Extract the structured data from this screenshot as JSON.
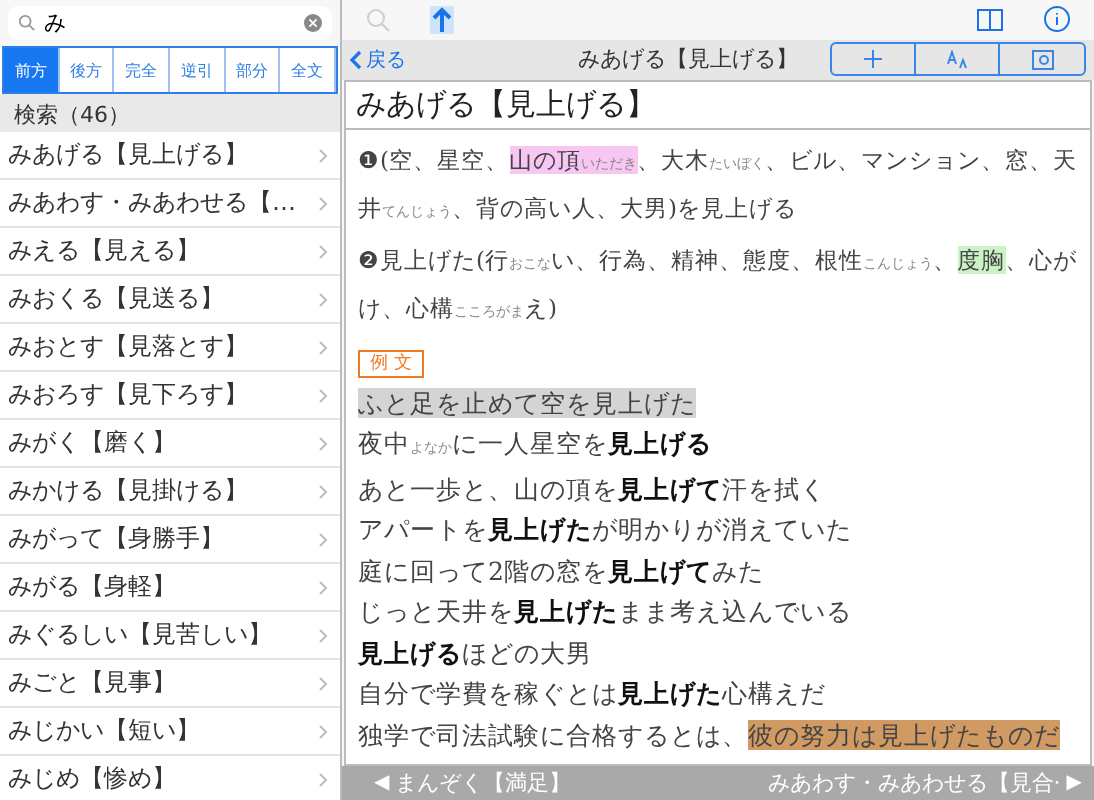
{
  "search": {
    "value": "み"
  },
  "modes": [
    {
      "label": "前方",
      "selected": true
    },
    {
      "label": "後方",
      "selected": false
    },
    {
      "label": "完全",
      "selected": false
    },
    {
      "label": "逆引",
      "selected": false
    },
    {
      "label": "部分",
      "selected": false
    },
    {
      "label": "全文",
      "selected": false
    }
  ],
  "results_header": "検索（46）",
  "results": [
    "みあげる【見上げる】",
    "みあわす・みあわせる【…",
    "みえる【見える】",
    "みおくる【見送る】",
    "みおとす【見落とす】",
    "みおろす【見下ろす】",
    "みがく【磨く】",
    "みかける【見掛ける】",
    "みがって【身勝手】",
    "みがる【身軽】",
    "みぐるしい【見苦しい】",
    "みごと【見事】",
    "みじかい【短い】",
    "みじめ【惨め】"
  ],
  "nav": {
    "back": "戻る",
    "title": "みあげる【見上げる】"
  },
  "entry": {
    "headword": "みあげる【見上げる】",
    "senses": [
      [
        {
          "text": "❶(空、星空、"
        },
        {
          "text": "山の頂$_{いただき}$",
          "color": "#f7c6f3"
        },
        {
          "text": "、大木$_{たいぼく}$、ビル、マンション、窓、天井$_{てんじょう}$、背の高い人、大男)を見上げる"
        }
      ],
      [
        {
          "text": "❷見上げた(行$_{おこな}$い、行為、精神、態度、根性$_{こんじょう}$、"
        },
        {
          "text": "度胸",
          "color": "#c9f3c6"
        },
        {
          "text": "、心がけ、心構$_{こころがま}$え)"
        }
      ]
    ],
    "examples_label": "例 文",
    "examples": [
      [
        {
          "text": "ふと足を止めて空を見上げた",
          "color": "#d4d4d4"
        }
      ],
      [
        {
          "text": "夜中$_{よなか}$に一人星空を**見上げる**"
        }
      ],
      [
        {
          "text": "あと一歩と、山の頂を**見上げて**汗を拭く"
        }
      ],
      [
        {
          "text": "アパートを**見上げた**が明かりが消えていた"
        }
      ],
      [
        {
          "text": "庭に回って2階の窓を**見上げて**みた"
        }
      ],
      [
        {
          "text": "じっと天井を**見上げた**まま考え込んでいる"
        }
      ],
      [
        {
          "text": "**見上げる**ほどの大男"
        }
      ],
      [
        {
          "text": "自分で学費を稼ぐとは**見上げた**心構えだ"
        }
      ],
      [
        {
          "text": "独学で司法試験に合格するとは、"
        },
        {
          "text": "彼の努力は見上げたものだ",
          "color": "#d19a63"
        }
      ]
    ]
  },
  "footer": {
    "previous_arrow": "◀",
    "previous": "まんぞく【満足】",
    "next": "みあわす・みあわせる【見合·",
    "next_arrow": "▶"
  }
}
